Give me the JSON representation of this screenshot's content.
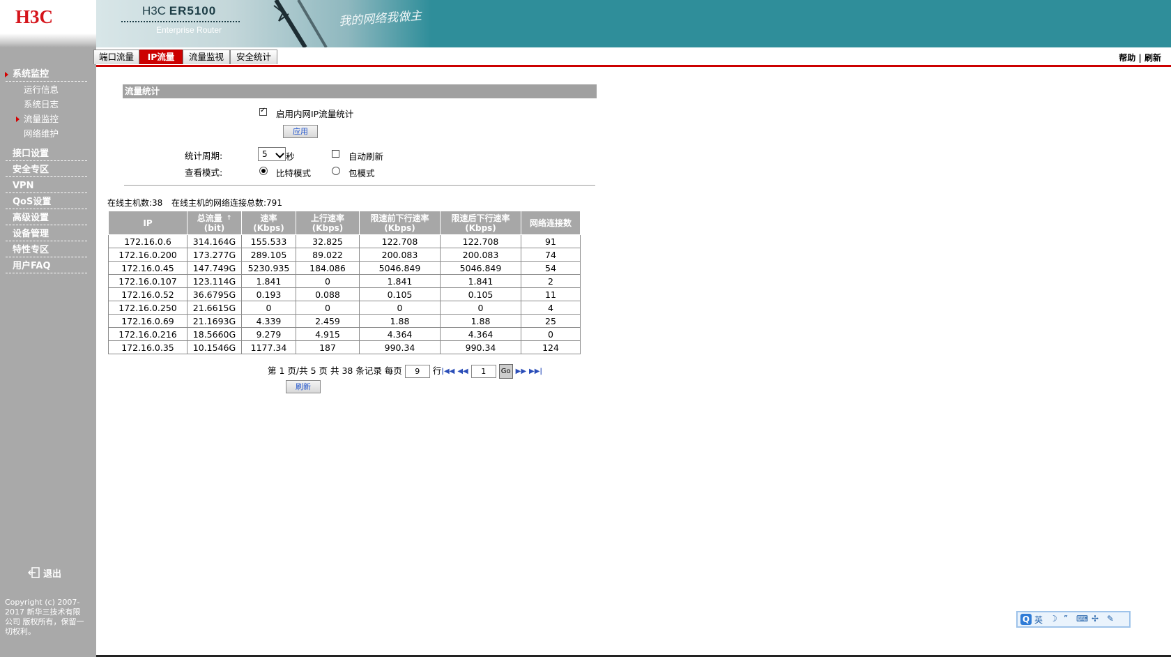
{
  "brand": {
    "logo": "H3C",
    "product_prefix": "H3C",
    "product_model": "ER5100",
    "product_subtitle": "Enterprise Router",
    "slogan": "我的网络我做主"
  },
  "sidebar": {
    "menus": [
      {
        "label": "系统监控",
        "active": true
      },
      {
        "label": "接口设置"
      },
      {
        "label": "安全专区"
      },
      {
        "label": "VPN"
      },
      {
        "label": "QoS设置"
      },
      {
        "label": "高级设置"
      },
      {
        "label": "设备管理"
      },
      {
        "label": "特性专区"
      },
      {
        "label": "用户FAQ"
      }
    ],
    "submenus": [
      {
        "label": "运行信息"
      },
      {
        "label": "系统日志"
      },
      {
        "label": "流量监控",
        "active": true
      },
      {
        "label": "网络维护"
      }
    ],
    "logout": "退出",
    "copyright": "Copyright (c) 2007-2017 新华三技术有限公司 版权所有，保留一切权利。"
  },
  "tabs": [
    {
      "label": "端口流量"
    },
    {
      "label": "IP流量",
      "active": true
    },
    {
      "label": "流量监视"
    },
    {
      "label": "安全统计"
    }
  ],
  "toplinks": {
    "help": "帮助",
    "sep": "|",
    "refresh": "刷新"
  },
  "section": {
    "title": "流量统计"
  },
  "form": {
    "enable_label": "启用内网IP流量统计",
    "enable_checked": true,
    "apply_button": "应用",
    "period_label": "统计周期:",
    "period_value": "5",
    "period_unit": "秒",
    "auto_refresh_label": "自动刷新",
    "auto_refresh_checked": false,
    "view_mode_label": "查看模式:",
    "mode_bit": "比特模式",
    "mode_packet": "包模式",
    "mode_selected": "bit"
  },
  "summary": {
    "online_hosts": "在线主机数:38",
    "total_connections": "在线主机的网络连接总数:791"
  },
  "table": {
    "headers": [
      {
        "line1": "IP",
        "line2": ""
      },
      {
        "line1": "总流量",
        "line2": "(bit)",
        "sort": "↑"
      },
      {
        "line1": "速率",
        "line2": "(Kbps)"
      },
      {
        "line1": "上行速率",
        "line2": "(Kbps)"
      },
      {
        "line1": "限速前下行速率",
        "line2": "(Kbps)"
      },
      {
        "line1": "限速后下行速率",
        "line2": "(Kbps)"
      },
      {
        "line1": "网络连接数",
        "line2": ""
      }
    ],
    "rows": [
      [
        "172.16.0.6",
        "314.164G",
        "155.533",
        "32.825",
        "122.708",
        "122.708",
        "91"
      ],
      [
        "172.16.0.200",
        "173.277G",
        "289.105",
        "89.022",
        "200.083",
        "200.083",
        "74"
      ],
      [
        "172.16.0.45",
        "147.749G",
        "5230.935",
        "184.086",
        "5046.849",
        "5046.849",
        "54"
      ],
      [
        "172.16.0.107",
        "123.114G",
        "1.841",
        "0",
        "1.841",
        "1.841",
        "2"
      ],
      [
        "172.16.0.52",
        "36.6795G",
        "0.193",
        "0.088",
        "0.105",
        "0.105",
        "11"
      ],
      [
        "172.16.0.250",
        "21.6615G",
        "0",
        "0",
        "0",
        "0",
        "4"
      ],
      [
        "172.16.0.69",
        "21.1693G",
        "4.339",
        "2.459",
        "1.88",
        "1.88",
        "25"
      ],
      [
        "172.16.0.216",
        "18.5660G",
        "9.279",
        "4.915",
        "4.364",
        "4.364",
        "0"
      ],
      [
        "172.16.0.35",
        "10.1546G",
        "1177.34",
        "187",
        "990.34",
        "990.34",
        "124"
      ]
    ]
  },
  "pager": {
    "text_before": "第 1 页/共 5 页 共 38 条记录 每页",
    "per_page": "9",
    "rows_unit": "行",
    "page_input": "1",
    "go": "Go",
    "refresh_button": "刷新"
  },
  "ime": {
    "lang": "英",
    "logo": "Q"
  },
  "colors": {
    "accent_red": "#cc0000",
    "header_teal": "#2f8e9a",
    "sidebar_gray": "#a9a9a9"
  }
}
